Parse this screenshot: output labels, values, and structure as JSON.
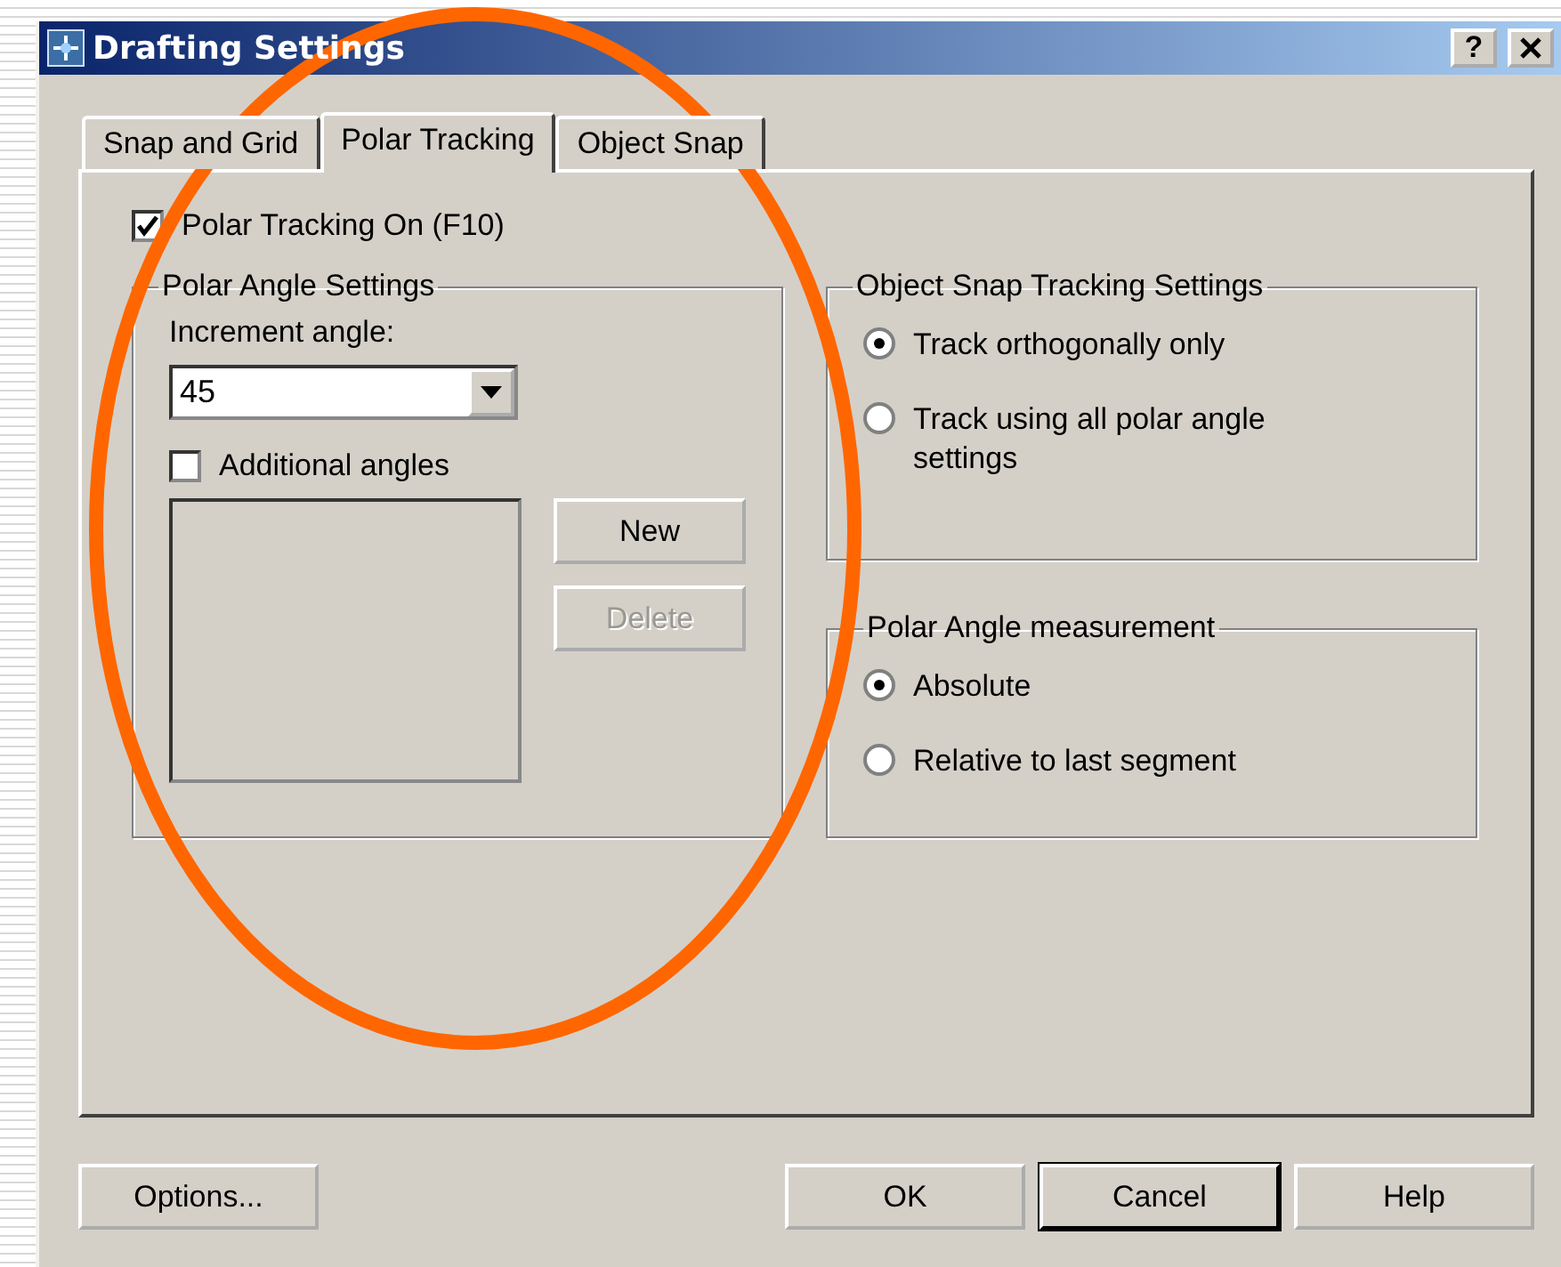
{
  "window": {
    "title": "Drafting Settings",
    "help_button": "?"
  },
  "tabs": [
    {
      "label": "Snap and Grid",
      "selected": false
    },
    {
      "label": "Polar Tracking",
      "selected": true
    },
    {
      "label": "Object Snap",
      "selected": false
    }
  ],
  "polar_tracking_on": {
    "label": "Polar Tracking On (F10)",
    "checked": true
  },
  "polar_angle_settings": {
    "title": "Polar Angle Settings",
    "increment_label": "Increment angle:",
    "increment_value": "45",
    "additional_angles": {
      "label": "Additional angles",
      "checked": false
    },
    "buttons": [
      {
        "label": "New",
        "disabled": false
      },
      {
        "label": "Delete",
        "disabled": true
      }
    ]
  },
  "object_snap_tracking_settings": {
    "title": "Object Snap Tracking Settings",
    "options": [
      {
        "label": "Track orthogonally only",
        "selected": true
      },
      {
        "label": "Track using all polar angle settings",
        "selected": false
      }
    ]
  },
  "polar_angle_measurement": {
    "title": "Polar Angle measurement",
    "options": [
      {
        "label": "Absolute",
        "selected": true
      },
      {
        "label": "Relative to last segment",
        "selected": false
      }
    ]
  },
  "buttons": [
    {
      "label": "Options...",
      "focused": false
    },
    {
      "label": "OK",
      "focused": false
    },
    {
      "label": "Cancel",
      "focused": true
    },
    {
      "label": "Help",
      "focused": false
    }
  ]
}
